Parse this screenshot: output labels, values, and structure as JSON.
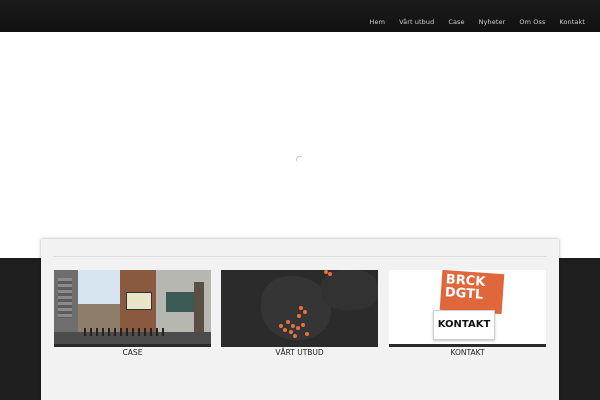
{
  "nav": {
    "items": [
      "Hem",
      "Vårt utbud",
      "Case",
      "Nyheter",
      "Om Oss",
      "Kontakt"
    ]
  },
  "cards": [
    {
      "caption": "CASE",
      "image": "street-photo"
    },
    {
      "caption": "VÅRT UTBUD",
      "image": "map-of-sweden"
    },
    {
      "caption": "KONTAKT",
      "image": "brckdgtl-logo",
      "logo_text": "BRCK DGTL",
      "sign_text": "KONTAKT"
    }
  ],
  "colors": {
    "topbar": "#151515",
    "darkband": "#1e1e1e",
    "panel": "#f2f2f2",
    "accent": "#e0673c"
  }
}
